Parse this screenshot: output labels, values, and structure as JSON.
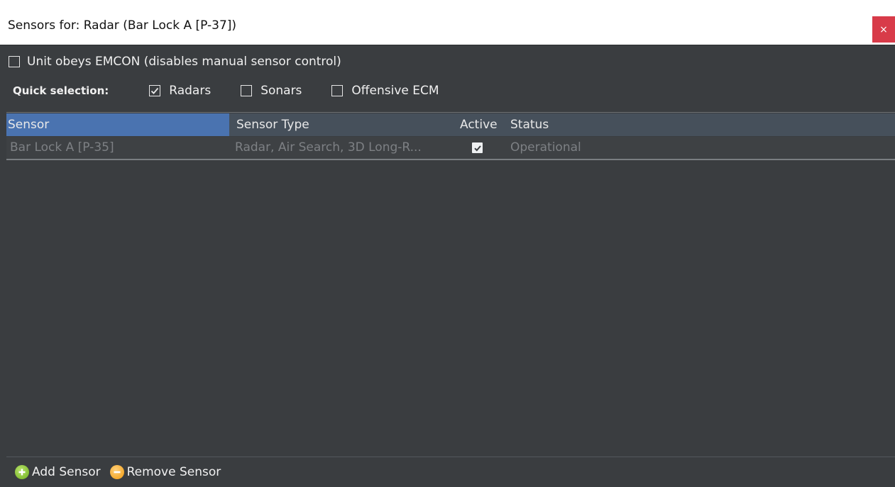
{
  "window": {
    "title": "Sensors for: Radar (Bar Lock A [P-37])",
    "close_label": "×"
  },
  "emcon": {
    "label": "Unit obeys EMCON (disables manual sensor control)",
    "checked": false
  },
  "quick_selection": {
    "label": "Quick selection:",
    "options": [
      {
        "label": "Radars",
        "checked": true
      },
      {
        "label": "Sonars",
        "checked": false
      },
      {
        "label": "Offensive ECM",
        "checked": false
      }
    ]
  },
  "grid": {
    "columns": [
      "Sensor",
      "Sensor Type",
      "Active",
      "Status"
    ],
    "rows": [
      {
        "sensor": "Bar Lock A [P-35]",
        "type": "Radar, Air Search, 3D Long-R...",
        "active": true,
        "status": "Operational"
      }
    ]
  },
  "footer": {
    "add_label": "Add Sensor",
    "remove_label": "Remove Sensor"
  },
  "colors": {
    "background": "#3a3d40",
    "header": "#46505b",
    "header_selected": "#4a73b0",
    "close": "#d83b49"
  }
}
